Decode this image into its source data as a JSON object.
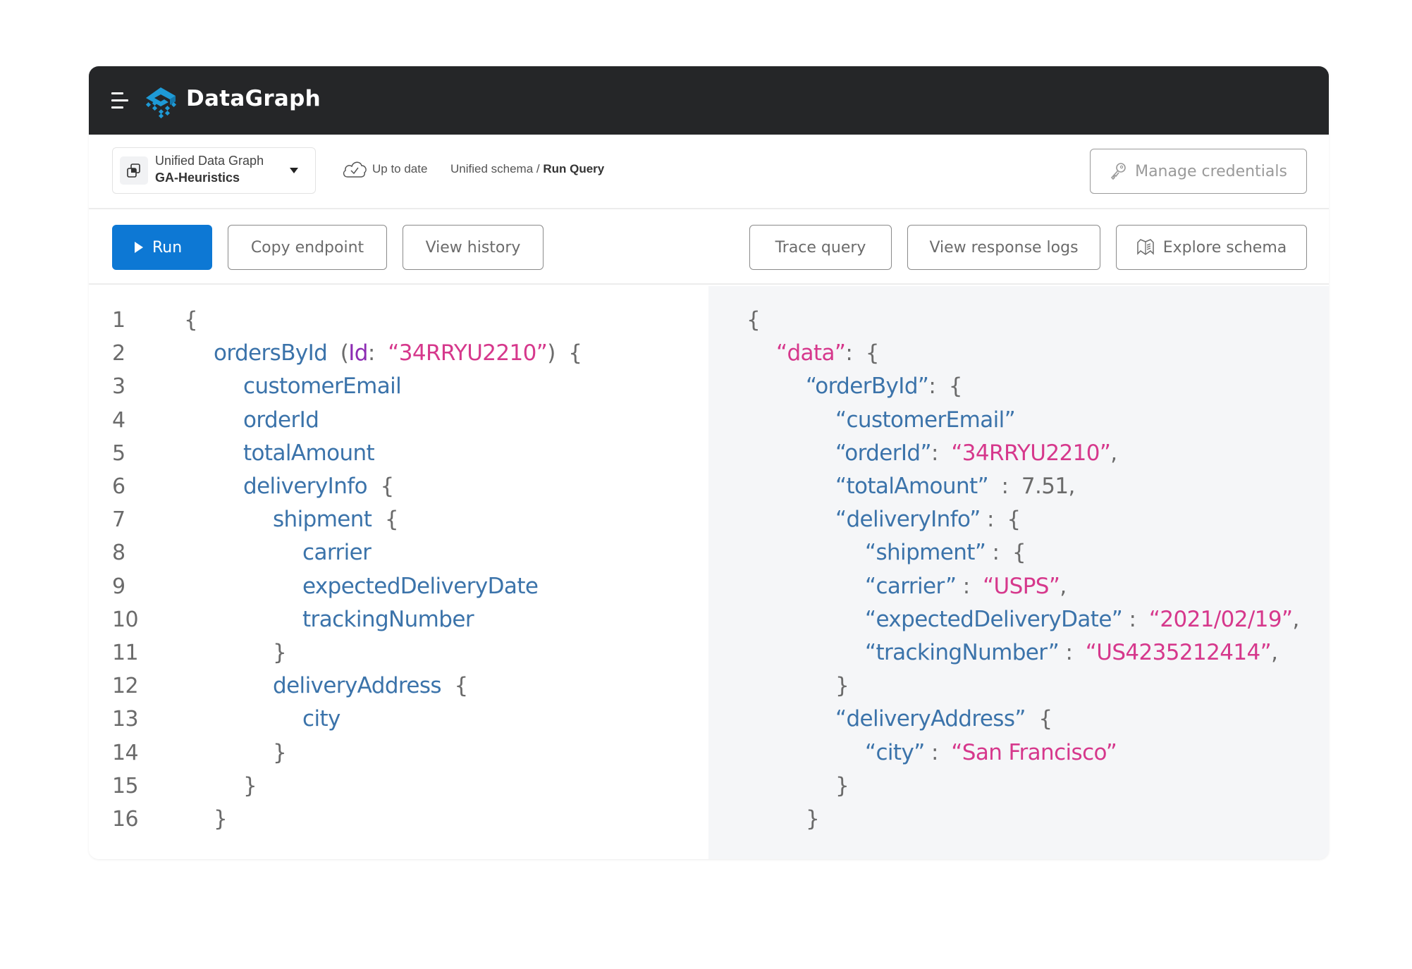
{
  "app": {
    "brand": "DataGraph",
    "menu_icon": "hamburger-menu-icon",
    "logo_icon": "datagraph-logo-icon"
  },
  "toolbar": {
    "graph_selector": {
      "label": "Unified Data Graph",
      "value": "GA-Heuristics",
      "icon": "layers-icon"
    },
    "status": {
      "icon": "cloud-check-icon",
      "text": "Up to date"
    },
    "breadcrumb": {
      "parent": "Unified schema / ",
      "current": "Run Query"
    },
    "manage_credentials": {
      "label": "Manage credentials",
      "icon": "key-icon"
    }
  },
  "actions": {
    "run": "Run",
    "copy_endpoint": "Copy endpoint",
    "view_history": "View history",
    "trace_query": "Trace query",
    "view_response_logs": "View response logs",
    "explore_schema": "Explore schema"
  },
  "colors": {
    "accent": "#0d78d4",
    "topbar": "#252628",
    "key": "#3b73aa",
    "string": "#d6388c",
    "argument": "#8d2cb3",
    "punctuation": "#6b6b6b",
    "result_bg": "#f5f6f8"
  },
  "query_lines": [
    {
      "n": "1",
      "indent": 0,
      "tokens": [
        [
          "p",
          "{"
        ]
      ]
    },
    {
      "n": "2",
      "indent": 1,
      "tokens": [
        [
          "k",
          "ordersById"
        ],
        [
          "p",
          "  ("
        ],
        [
          "a",
          "Id"
        ],
        [
          "p",
          ":  "
        ],
        [
          "s",
          "“34RRYU2210”"
        ],
        [
          "p",
          ")  {"
        ]
      ]
    },
    {
      "n": "3",
      "indent": 2,
      "tokens": [
        [
          "k",
          "customerEmail"
        ]
      ]
    },
    {
      "n": "4",
      "indent": 2,
      "tokens": [
        [
          "k",
          "orderId"
        ]
      ]
    },
    {
      "n": "5",
      "indent": 2,
      "tokens": [
        [
          "k",
          "totalAmount"
        ]
      ]
    },
    {
      "n": "6",
      "indent": 2,
      "tokens": [
        [
          "k",
          "deliveryInfo"
        ],
        [
          "p",
          "  {"
        ]
      ]
    },
    {
      "n": "7",
      "indent": 3,
      "tokens": [
        [
          "k",
          "shipment"
        ],
        [
          "p",
          "  {"
        ]
      ]
    },
    {
      "n": "8",
      "indent": 4,
      "tokens": [
        [
          "k",
          "carrier"
        ]
      ]
    },
    {
      "n": "9",
      "indent": 4,
      "tokens": [
        [
          "k",
          "expectedDeliveryDate"
        ]
      ]
    },
    {
      "n": "10",
      "indent": 4,
      "tokens": [
        [
          "k",
          "trackingNumber"
        ]
      ]
    },
    {
      "n": "11",
      "indent": 3,
      "tokens": [
        [
          "p",
          "}"
        ]
      ]
    },
    {
      "n": "12",
      "indent": 3,
      "tokens": [
        [
          "k",
          "deliveryAddress"
        ],
        [
          "p",
          "  {"
        ]
      ]
    },
    {
      "n": "13",
      "indent": 4,
      "tokens": [
        [
          "k",
          "city"
        ]
      ]
    },
    {
      "n": "14",
      "indent": 3,
      "tokens": [
        [
          "p",
          "}"
        ]
      ]
    },
    {
      "n": "15",
      "indent": 2,
      "tokens": [
        [
          "p",
          "}"
        ]
      ]
    },
    {
      "n": "16",
      "indent": 1,
      "tokens": [
        [
          "p",
          "}"
        ]
      ]
    }
  ],
  "result_lines": [
    {
      "indent": 0,
      "tokens": [
        [
          "p",
          "{"
        ]
      ]
    },
    {
      "indent": 1,
      "tokens": [
        [
          "s",
          "“data”"
        ],
        [
          "p",
          ":  {"
        ]
      ]
    },
    {
      "indent": 2,
      "tokens": [
        [
          "k",
          "“orderById”"
        ],
        [
          "p",
          ":  {"
        ]
      ]
    },
    {
      "indent": 3,
      "tokens": [
        [
          "k",
          "“customerEmail”"
        ]
      ]
    },
    {
      "indent": 3,
      "tokens": [
        [
          "k",
          "“orderId”"
        ],
        [
          "p",
          ":  "
        ],
        [
          "s",
          "“34RRYU2210”"
        ],
        [
          "p",
          ","
        ]
      ]
    },
    {
      "indent": 3,
      "tokens": [
        [
          "k",
          "“totalAmount”"
        ],
        [
          "p",
          "  :  "
        ],
        [
          "n",
          "7.51"
        ],
        [
          "p",
          ","
        ]
      ]
    },
    {
      "indent": 3,
      "tokens": [
        [
          "k",
          "“deliveryInfo”"
        ],
        [
          "p",
          " :  {"
        ]
      ]
    },
    {
      "indent": 4,
      "tokens": [
        [
          "k",
          "“shipment”"
        ],
        [
          "p",
          " :  {"
        ]
      ]
    },
    {
      "indent": 4,
      "tokens": [
        [
          "k",
          "“carrier”"
        ],
        [
          "p",
          " :  "
        ],
        [
          "s",
          "“USPS”"
        ],
        [
          "p",
          ","
        ]
      ]
    },
    {
      "indent": 4,
      "tokens": [
        [
          "k",
          "“expectedDeliveryDate”"
        ],
        [
          "p",
          " :  "
        ],
        [
          "s",
          "“2021/02/19”"
        ],
        [
          "p",
          ","
        ]
      ]
    },
    {
      "indent": 4,
      "tokens": [
        [
          "k",
          "“trackingNumber”"
        ],
        [
          "p",
          " :  "
        ],
        [
          "s",
          "“US4235212414”"
        ],
        [
          "p",
          ","
        ]
      ]
    },
    {
      "indent": 3,
      "tokens": [
        [
          "p",
          "}"
        ]
      ]
    },
    {
      "indent": 3,
      "tokens": [
        [
          "k",
          "“deliveryAddress”"
        ],
        [
          "p",
          "  {"
        ]
      ]
    },
    {
      "indent": 4,
      "tokens": [
        [
          "k",
          "“city”"
        ],
        [
          "p",
          " :  "
        ],
        [
          "s",
          "“San Francisco”"
        ]
      ]
    },
    {
      "indent": 3,
      "tokens": [
        [
          "p",
          "}"
        ]
      ]
    },
    {
      "indent": 2,
      "tokens": [
        [
          "p",
          "}"
        ]
      ]
    }
  ]
}
